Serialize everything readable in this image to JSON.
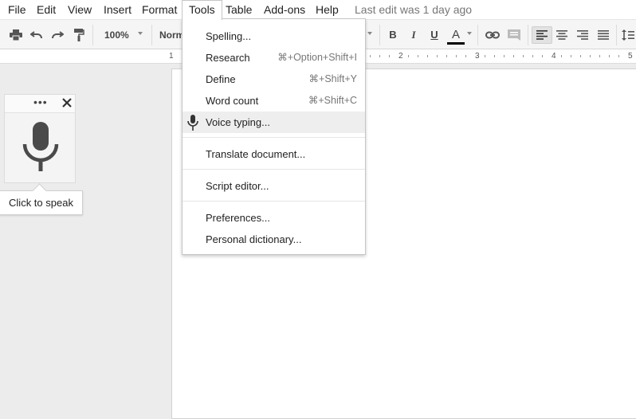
{
  "menubar": {
    "items": [
      {
        "label": "File"
      },
      {
        "label": "Edit"
      },
      {
        "label": "View"
      },
      {
        "label": "Insert"
      },
      {
        "label": "Format"
      },
      {
        "label": "Tools",
        "active": true
      },
      {
        "label": "Table"
      },
      {
        "label": "Add-ons"
      },
      {
        "label": "Help"
      }
    ],
    "last_edit": "Last edit was 1 day ago"
  },
  "toolbar": {
    "zoom": "100%",
    "style": "Norm",
    "bold": "B",
    "italic": "I",
    "underline": "U",
    "text_color": "A",
    "text_color_value": "#000000",
    "icons": [
      "print-icon",
      "undo-icon",
      "redo-icon",
      "paint-format-icon",
      "link-icon",
      "comment-icon",
      "align-left-icon",
      "align-center-icon",
      "align-right-icon",
      "justify-icon",
      "line-spacing-icon"
    ]
  },
  "ruler": {
    "numbers": [
      "1",
      "2",
      "3",
      "4",
      "5"
    ]
  },
  "tools_menu": {
    "items": [
      {
        "label": "Spelling...",
        "shortcut": ""
      },
      {
        "label": "Research",
        "shortcut": "⌘+Option+Shift+I"
      },
      {
        "label": "Define",
        "shortcut": "⌘+Shift+Y"
      },
      {
        "label": "Word count",
        "shortcut": "⌘+Shift+C"
      },
      {
        "label": "Voice typing...",
        "shortcut": "",
        "icon": "microphone-icon",
        "highlighted": true
      },
      {
        "label": "Translate document...",
        "shortcut": ""
      },
      {
        "label": "Script editor...",
        "shortcut": ""
      },
      {
        "label": "Preferences...",
        "shortcut": ""
      },
      {
        "label": "Personal dictionary...",
        "shortcut": ""
      }
    ]
  },
  "voice_widget": {
    "menu_dots": "•••",
    "tooltip": "Click to speak",
    "icons": [
      "more-icon",
      "close-icon",
      "microphone-icon"
    ]
  }
}
